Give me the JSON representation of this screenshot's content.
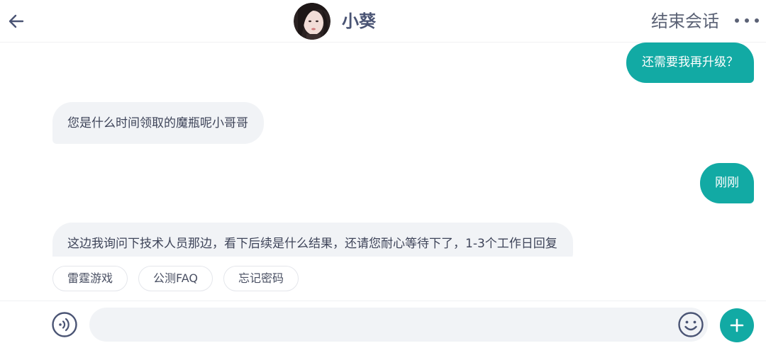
{
  "header": {
    "back_icon": "arrow-left-icon",
    "title": "小葵",
    "end_session": "结束会话",
    "more_icon": "more-dots-icon"
  },
  "messages": [
    {
      "side": "out",
      "text": "还需要我再升级？"
    },
    {
      "side": "in",
      "text": "您是什么时间领取的魔瓶呢小哥哥"
    },
    {
      "side": "out",
      "text": "刚刚"
    },
    {
      "side": "in",
      "text": "这边我询问下技术人员那边，看下后续是什么结果，还请您耐心等待下了，1-3个工作日回复"
    }
  ],
  "quick_replies": [
    "雷霆游戏",
    "公测FAQ",
    "忘记密码"
  ],
  "input": {
    "value": "",
    "placeholder": "",
    "voice_icon": "voice-icon",
    "emoji_icon": "emoji-icon",
    "plus_icon": "plus-icon"
  },
  "colors": {
    "accent": "#12aaa4",
    "incoming_bubble": "#f1f3f6",
    "header_text": "#4a5474"
  }
}
